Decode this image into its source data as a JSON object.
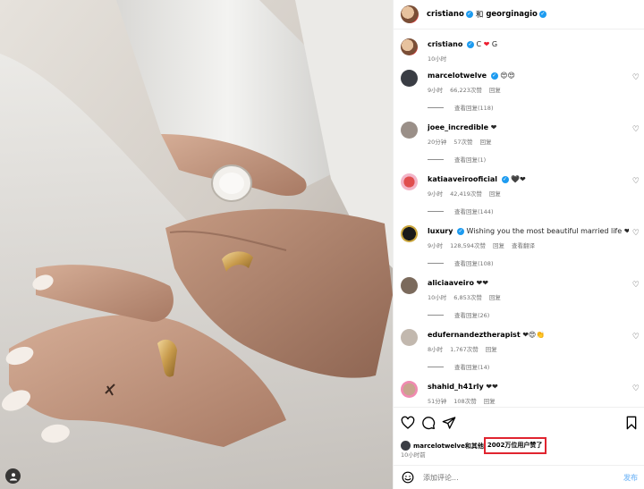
{
  "header": {
    "user1": "cristiano",
    "joiner": "和",
    "user2": "georginagio"
  },
  "caption": {
    "user": "cristiano",
    "text_c": "C",
    "heart": "❤",
    "text_g": "G",
    "time": "10小时"
  },
  "comments": [
    {
      "user": "marcelotwelve",
      "verified": true,
      "text": "😍😍",
      "time": "9小时",
      "likes": "66,223次赞",
      "reply": "回复",
      "view_replies": "查看回复(118)"
    },
    {
      "user": "joee_incredible",
      "verified": false,
      "text": "❤",
      "time": "20分钟",
      "likes": "57次赞",
      "reply": "回复",
      "view_replies": "查看回复(1)"
    },
    {
      "user": "katiaaveirooficial",
      "verified": true,
      "text": "🖤❤",
      "time": "9小时",
      "likes": "42,419次赞",
      "reply": "回复",
      "view_replies": "查看回复(144)"
    },
    {
      "user": "luxury",
      "verified": true,
      "text": "Wishing you the most beautiful married life ❤",
      "time": "9小时",
      "likes": "128,594次赞",
      "reply": "回复",
      "translate": "查看翻译",
      "view_replies": "查看回复(108)"
    },
    {
      "user": "aliciaaveiro",
      "verified": false,
      "text": "❤❤",
      "time": "10小时",
      "likes": "6,853次赞",
      "reply": "回复",
      "view_replies": "查看回复(26)"
    },
    {
      "user": "edufernandeztherapist",
      "verified": false,
      "text": "❤😍👏",
      "time": "8小时",
      "likes": "1,767次赞",
      "reply": "回复",
      "view_replies": "查看回复(14)"
    },
    {
      "user": "shahid_h41rly",
      "verified": false,
      "text": "❤❤",
      "time": "51分钟",
      "likes": "108次赞",
      "reply": "回复"
    }
  ],
  "likes": {
    "prefix": "marcelotwelve和其他",
    "count_text": "2002万位用户赞了"
  },
  "post_time": "10小时前",
  "add_comment": {
    "placeholder": "添加评论...",
    "post_label": "发布"
  },
  "colors": {
    "verified": "#1d9bf0",
    "heart_red": "#ed1c2e",
    "highlight_box": "#e0242f",
    "post_button": "#8ec4f8"
  },
  "icons": [
    "user-tag-icon",
    "heart-icon",
    "comment-icon",
    "share-icon",
    "bookmark-icon",
    "emoji-icon"
  ]
}
